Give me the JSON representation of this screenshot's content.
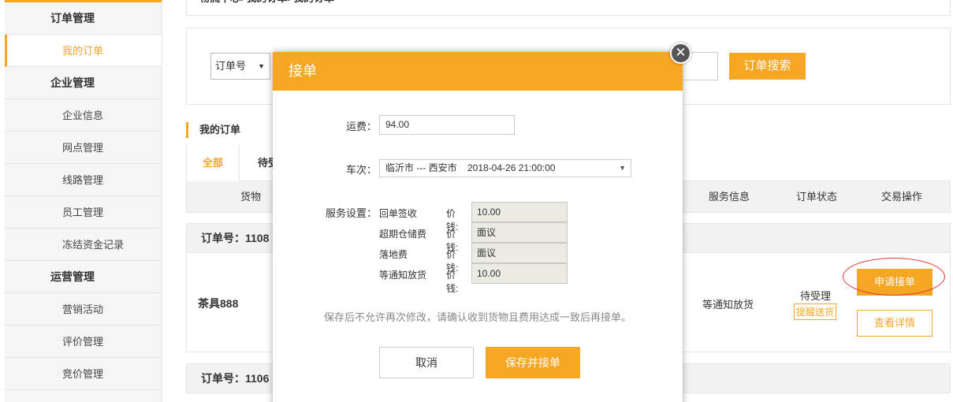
{
  "sidebar": {
    "groups": [
      {
        "label": "订单管理",
        "items": [
          {
            "label": "我的订单"
          }
        ]
      },
      {
        "label": "企业管理",
        "items": [
          {
            "label": "企业信息"
          },
          {
            "label": "网点管理"
          },
          {
            "label": "线路管理"
          },
          {
            "label": "员工管理"
          },
          {
            "label": "冻结资金记录"
          }
        ]
      },
      {
        "label": "运营管理",
        "items": [
          {
            "label": "营销活动"
          },
          {
            "label": "评价管理"
          },
          {
            "label": "竞价管理"
          }
        ]
      }
    ]
  },
  "breadcrumb": "物流中心>我的订单>我的订单",
  "search": {
    "select_value": "订单号",
    "button_label": "订单搜索"
  },
  "section_title": "我的订单",
  "tabs": [
    {
      "label": "全部"
    },
    {
      "label": "待受"
    }
  ],
  "table_headers": {
    "goods": "货物",
    "service": "服务信息",
    "status": "订单状态",
    "action": "交易操作"
  },
  "orders": [
    {
      "number_label": "订单号：1108",
      "goods": "茶具888",
      "service": "等通知放货",
      "status": "待受理",
      "remind": "提醒送货",
      "apply_label": "申请接单",
      "detail_label": "查看详情"
    },
    {
      "number_label": "订单号：1106"
    }
  ],
  "modal": {
    "title": "接单",
    "close_symbol": "✕",
    "freight_label": "运费：",
    "freight_value": "94.00",
    "trip_label": "车次：",
    "trip_value": "临沂市 --- 西安市    2018-04-26 21:00:00",
    "service_label": "服务设置：",
    "price_label": "价钱:",
    "services": [
      {
        "name": "回单签收",
        "price": "10.00"
      },
      {
        "name": "超期仓储费",
        "price": "面议"
      },
      {
        "name": "落地费",
        "price": "面议"
      },
      {
        "name": "等通知放货",
        "price": "10.00"
      }
    ],
    "notice": "保存后不允许再次修改，请确认收到货物且费用达成一致后再接单。",
    "cancel_label": "取消",
    "save_label": "保存并接单"
  }
}
